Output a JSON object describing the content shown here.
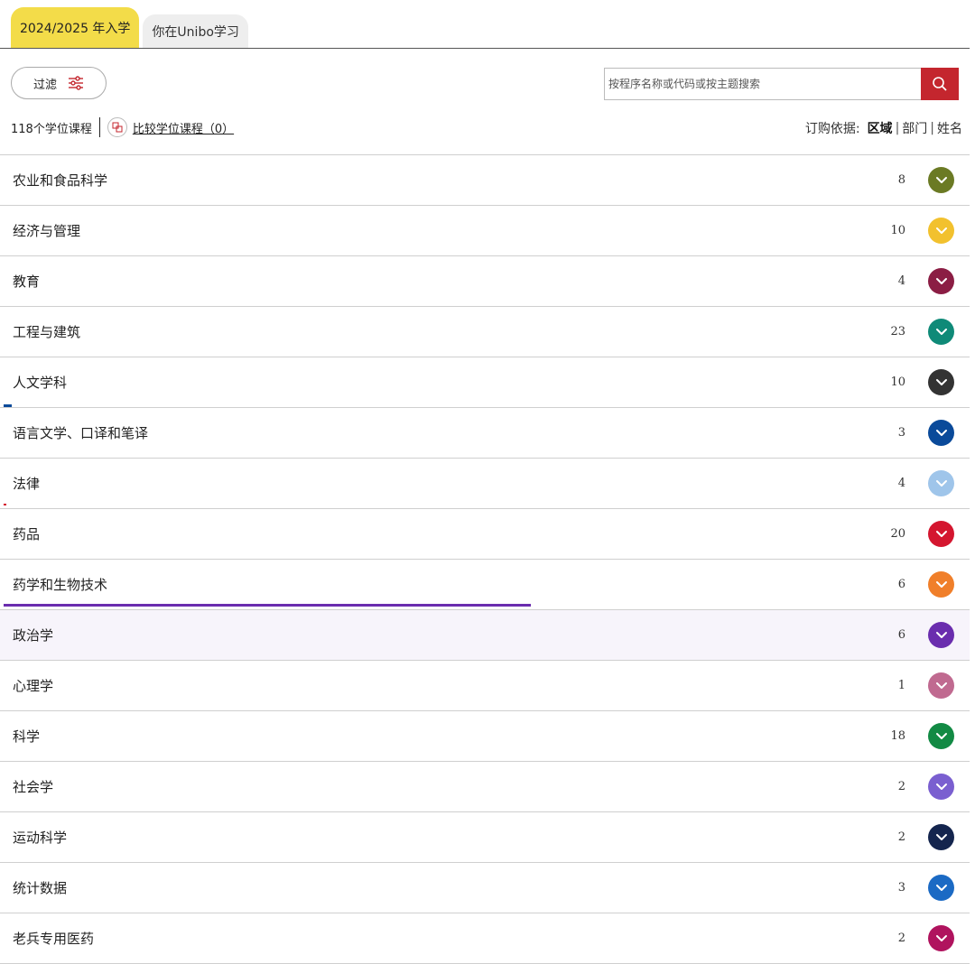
{
  "tabs": [
    {
      "label": "2024/2025 年入学",
      "active": true
    },
    {
      "label": "你在Unibo学习",
      "active": false
    }
  ],
  "filter": {
    "label": "过滤",
    "icon": "sliders-icon"
  },
  "search": {
    "placeholder": "按程序名称或代码或按主题搜索",
    "value": "",
    "icon": "search-icon"
  },
  "results": {
    "count_label": "118个学位课程",
    "compare_label": "比较学位课程（0）"
  },
  "sort": {
    "label": "订购依据:",
    "options": [
      "区域",
      "部门",
      "姓名"
    ],
    "active": "区域"
  },
  "areas": [
    {
      "name": "农业和食品科学",
      "count": "8",
      "color": "#6b7a24"
    },
    {
      "name": "经济与管理",
      "count": "10",
      "color": "#f2c12e"
    },
    {
      "name": "教育",
      "count": "4",
      "color": "#8b1d44"
    },
    {
      "name": "工程与建筑",
      "count": "23",
      "color": "#0f8a78"
    },
    {
      "name": "人文学科",
      "count": "10",
      "color": "#333333"
    },
    {
      "name": "语言文学、口译和笔译",
      "count": "3",
      "color": "#0a4a9a"
    },
    {
      "name": "法律",
      "count": "4",
      "color": "#9fc5ea"
    },
    {
      "name": "药品",
      "count": "20",
      "color": "#d4162f"
    },
    {
      "name": "药学和生物技术",
      "count": "6",
      "color": "#f07f2a"
    },
    {
      "name": "政治学",
      "count": "6",
      "color": "#6a2dae"
    },
    {
      "name": "心理学",
      "count": "1",
      "color": "#c06a90"
    },
    {
      "name": "科学",
      "count": "18",
      "color": "#128a44"
    },
    {
      "name": "社会学",
      "count": "2",
      "color": "#7a5fd0"
    },
    {
      "name": "运动科学",
      "count": "2",
      "color": "#14254e"
    },
    {
      "name": "统计数据",
      "count": "3",
      "color": "#1b6ac4"
    },
    {
      "name": "老兵专用医药",
      "count": "2",
      "color": "#b0135e"
    }
  ],
  "colors": {
    "accent": "#c4262e",
    "tab_active": "#f3dc49",
    "hover_row": "#f7f4fb"
  }
}
